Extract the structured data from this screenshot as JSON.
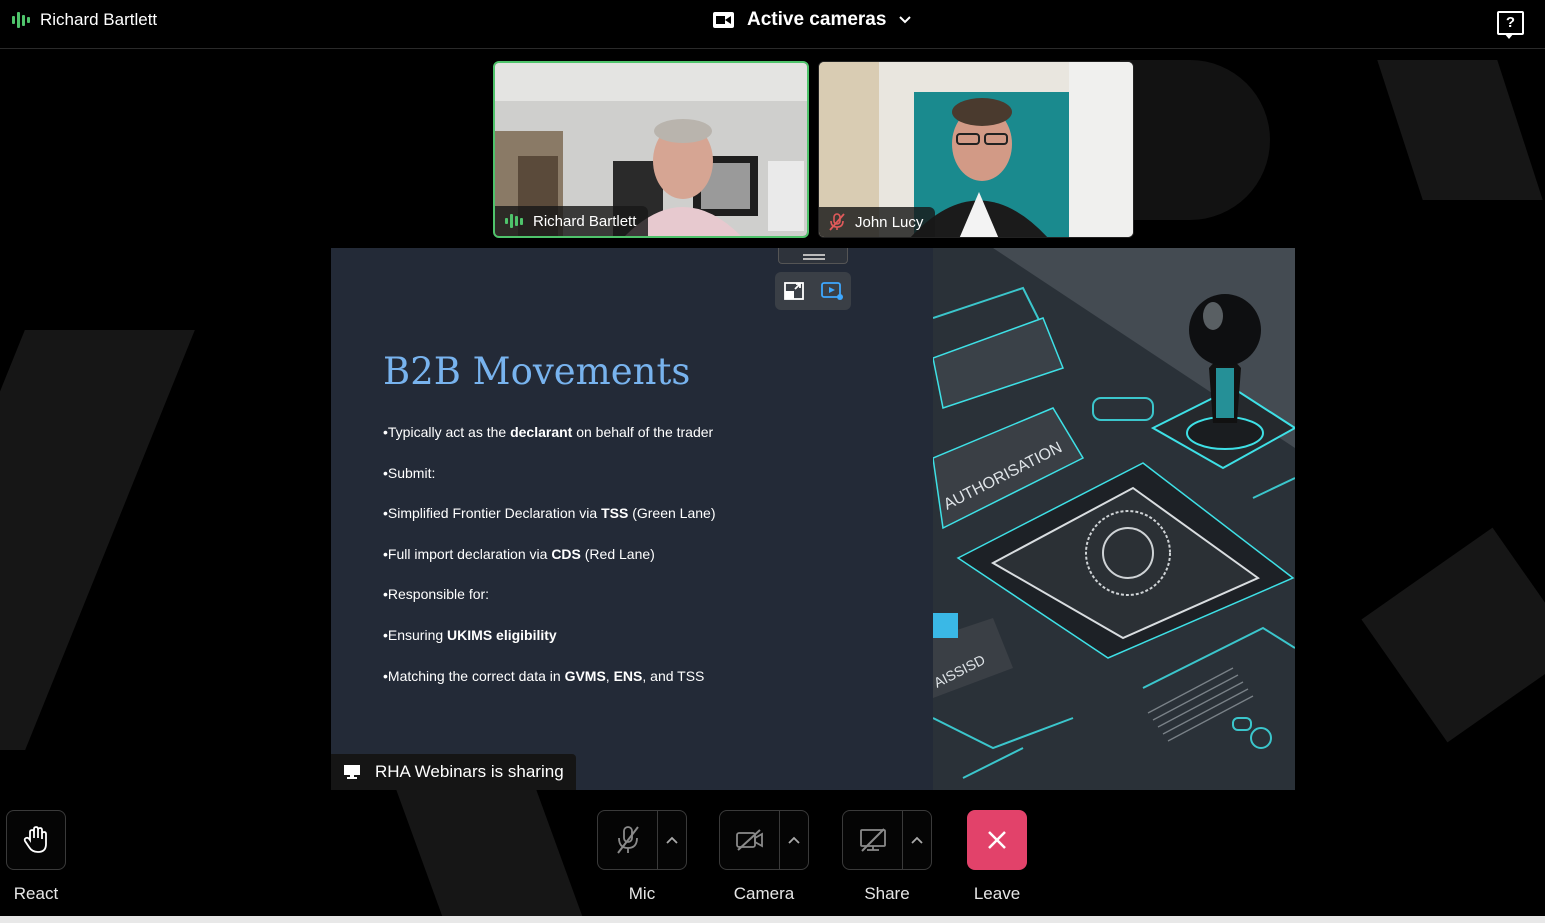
{
  "topbar": {
    "speaker_name": "Richard Bartlett",
    "view_label": "Active cameras",
    "help_icon": "help-icon"
  },
  "participants": [
    {
      "name": "Richard Bartlett",
      "status": "speaking",
      "active": true
    },
    {
      "name": "John Lucy",
      "status": "muted",
      "active": false
    }
  ],
  "slide": {
    "title": "B2B Movements",
    "bullets": [
      [
        {
          "t": "•Typically act as the "
        },
        {
          "t": "declarant",
          "b": true
        },
        {
          "t": " on behalf of the trader"
        }
      ],
      [
        {
          "t": "•Submit:"
        }
      ],
      [
        {
          "t": "•Simplified Frontier Declaration via "
        },
        {
          "t": "TSS",
          "b": true
        },
        {
          "t": " (Green Lane)"
        }
      ],
      [
        {
          "t": "•Full import declaration via "
        },
        {
          "t": "CDS",
          "b": true
        },
        {
          "t": " (Red Lane)"
        }
      ],
      [
        {
          "t": "•Responsible for:"
        }
      ],
      [
        {
          "t": "•Ensuring "
        },
        {
          "t": "UKIMS eligibility",
          "b": true
        }
      ],
      [
        {
          "t": "•Matching the correct data in "
        },
        {
          "t": "GVMS",
          "b": true
        },
        {
          "t": ", "
        },
        {
          "t": "ENS",
          "b": true
        },
        {
          "t": ", and TSS"
        }
      ]
    ],
    "art_labels": [
      "AUTHORISATION",
      "AISSISD"
    ]
  },
  "sharing_text": "RHA Webinars is sharing",
  "controls": {
    "react": "React",
    "mic": "Mic",
    "camera": "Camera",
    "share": "Share",
    "leave": "Leave"
  },
  "colors": {
    "accent_green": "#4fc36b",
    "leave_red": "#e2426a",
    "slide_bg": "#232a37",
    "slide_title": "#78b3ee",
    "muted_red": "#e05a5a"
  }
}
